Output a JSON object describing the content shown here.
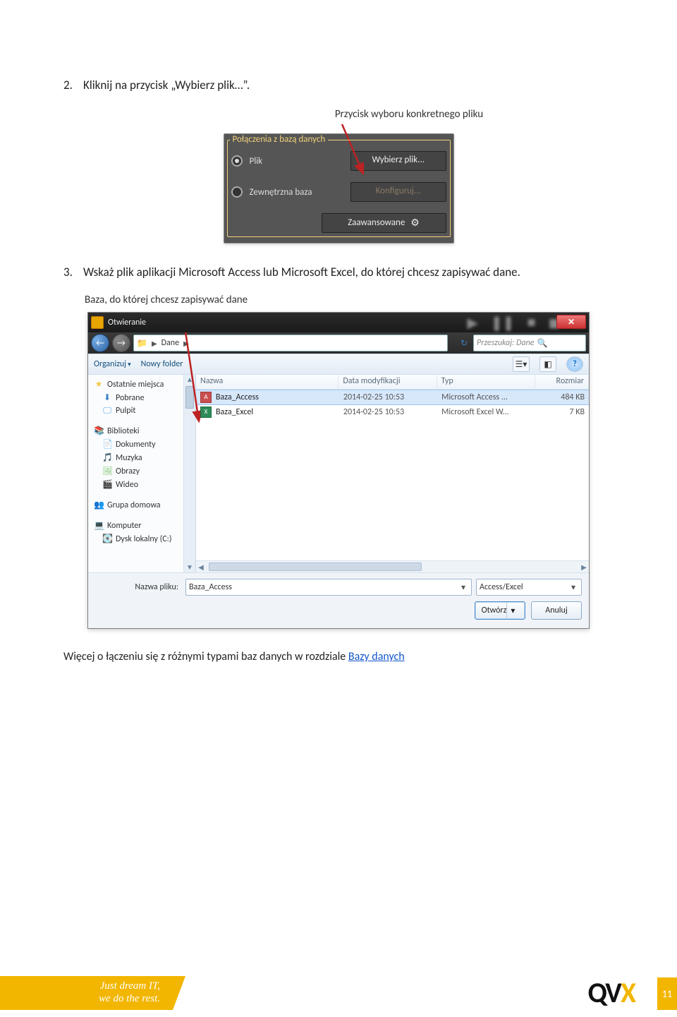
{
  "steps": {
    "s2": {
      "num": "2.",
      "text": "Kliknij na przycisk „Wybierz plik…”."
    },
    "s3": {
      "num": "3.",
      "text": "Wskaż plik aplikacji Microsoft Access lub Microsoft Excel, do której chcesz zapisywać dane."
    }
  },
  "caption1": "Przycisk wyboru konkretnego pliku",
  "dark_panel": {
    "legend": "Połączenia z bazą danych",
    "radio_file": "Plik",
    "radio_ext": "Zewnętrzna baza",
    "btn_pick": "Wybierz plik...",
    "btn_cfg": "Konfiguruj...",
    "btn_adv": "Zaawansowane"
  },
  "caption2": "Baza, do której chcesz zapisywać dane",
  "open_dialog": {
    "title": "Otwieranie",
    "breadcrumb": "Dane",
    "search_placeholder": "Przeszukaj: Dane",
    "toolbar": {
      "organize": "Organizuj",
      "newfolder": "Nowy folder"
    },
    "side": {
      "recent": "Ostatnie miejsca",
      "downloads": "Pobrane",
      "desktop": "Pulpit",
      "libraries": "Biblioteki",
      "documents": "Dokumenty",
      "music": "Muzyka",
      "pictures": "Obrazy",
      "video": "Wideo",
      "homegroup": "Grupa domowa",
      "computer": "Komputer",
      "diskc": "Dysk lokalny (C:)"
    },
    "columns": {
      "name": "Nazwa",
      "date": "Data modyfikacji",
      "type": "Typ",
      "size": "Rozmiar"
    },
    "rows": [
      {
        "name": "Baza_Access",
        "date": "2014-02-25 10:53",
        "type": "Microsoft Access ...",
        "size": "484 KB",
        "icon": "access",
        "selected": true
      },
      {
        "name": "Baza_Excel",
        "date": "2014-02-25 10:53",
        "type": "Microsoft Excel W...",
        "size": "7 KB",
        "icon": "excel",
        "selected": false
      }
    ],
    "filename_label": "Nazwa pliku:",
    "filename_value": "Baza_Access",
    "type_filter": "Access/Excel",
    "open_btn": "Otwórz",
    "cancel_btn": "Anuluj"
  },
  "after": {
    "text": "Więcej o łączeniu się z różnymi typami baz danych w rozdziale ",
    "link": "Bazy danych"
  },
  "footer": {
    "line1": "Just dream IT,",
    "line2": "we do the rest.",
    "page": "11",
    "logo_a": "QV",
    "logo_b": "X"
  }
}
